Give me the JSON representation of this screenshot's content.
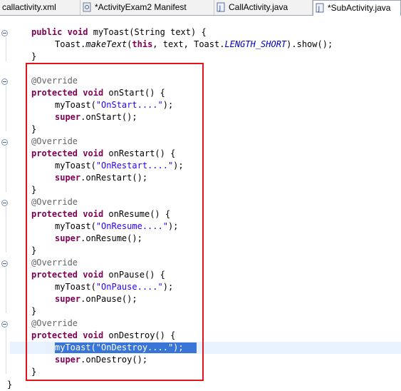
{
  "tabs": [
    {
      "label": "callactivity.xml",
      "icon": "xml-file-icon"
    },
    {
      "label": "*ActivityExam2 Manifest",
      "icon": "manifest-icon"
    },
    {
      "label": "CallActivity.java",
      "icon": "java-file-icon"
    },
    {
      "label": "*SubActivity.java",
      "icon": "java-file-icon",
      "active": true
    }
  ],
  "code": {
    "myToast_sig": {
      "kw1": "public",
      "kw2": "void",
      "rest": "myToast(String text) {"
    },
    "toast_call": {
      "a": "Toast.",
      "b": "makeText",
      "c": "(",
      "kw": "this",
      "d": ", text, Toast.",
      "field": "LENGTH_SHORT",
      "e": ").show();"
    },
    "close_brace": "}",
    "override": "@Override",
    "protected": "protected",
    "void": "void",
    "super": "super",
    "methods": [
      {
        "sig": "onStart() {",
        "arg": "\"OnStart....\"",
        "super_call": ".onStart();"
      },
      {
        "sig": "onRestart() {",
        "arg": "\"OnRestart....\"",
        "super_call": ".onRestart();"
      },
      {
        "sig": "onResume() {",
        "arg": "\"OnResume....\"",
        "super_call": ".onResume();"
      },
      {
        "sig": "onPause() {",
        "arg": "\"OnPause....\"",
        "super_call": ".onPause();"
      },
      {
        "sig": "onDestroy() {",
        "arg": "\"OnDestroy....\"",
        "super_call": ".onDestroy();"
      }
    ],
    "myToast_prefix": "myToast(",
    "call_suffix": ");",
    "selected_line": "myToast(\"OnDestroy....\");"
  },
  "colors": {
    "keyword": "#7f0055",
    "string": "#2a00ff",
    "annotation": "#646464",
    "highlight_box": "#e0141a",
    "selection": "#3875d7"
  }
}
